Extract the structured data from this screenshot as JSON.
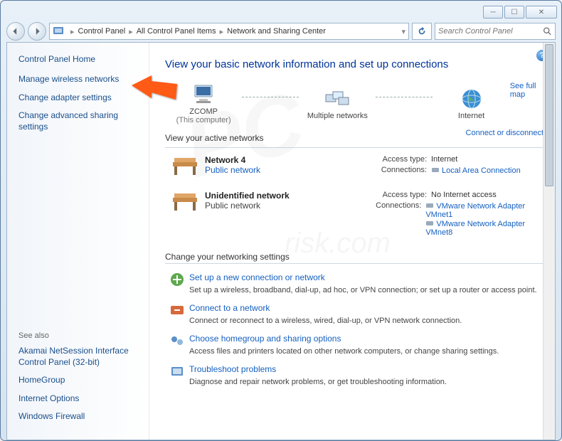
{
  "breadcrumbs": [
    "Control Panel",
    "All Control Panel Items",
    "Network and Sharing Center"
  ],
  "search": {
    "placeholder": "Search Control Panel"
  },
  "sidebar": {
    "home": "Control Panel Home",
    "links": [
      "Manage wireless networks",
      "Change adapter settings",
      "Change advanced sharing settings"
    ],
    "see_also_label": "See also",
    "see_also": [
      "Akamai NetSession Interface Control Panel (32-bit)",
      "HomeGroup",
      "Internet Options",
      "Windows Firewall"
    ]
  },
  "main": {
    "heading": "View your basic network information and set up connections",
    "see_full_map": "See full map",
    "nodes": {
      "computer": {
        "label": "ZCOMP",
        "sub": "(This computer)"
      },
      "middle": {
        "label": "Multiple networks"
      },
      "internet": {
        "label": "Internet"
      }
    },
    "active_label": "View your active networks",
    "cd_link": "Connect or disconnect",
    "networks": [
      {
        "name": "Network  4",
        "type": "Public network",
        "type_link": true,
        "access_lbl": "Access type:",
        "access_val": "Internet",
        "conn_lbl": "Connections:",
        "connections": [
          "Local Area Connection"
        ]
      },
      {
        "name": "Unidentified network",
        "type": "Public network",
        "type_link": false,
        "access_lbl": "Access type:",
        "access_val": "No Internet access",
        "conn_lbl": "Connections:",
        "connections": [
          "VMware Network Adapter VMnet1",
          "VMware Network Adapter VMnet8"
        ]
      }
    ],
    "change_settings_label": "Change your networking settings",
    "settings": [
      {
        "title": "Set up a new connection or network",
        "desc": "Set up a wireless, broadband, dial-up, ad hoc, or VPN connection; or set up a router or access point."
      },
      {
        "title": "Connect to a network",
        "desc": "Connect or reconnect to a wireless, wired, dial-up, or VPN network connection."
      },
      {
        "title": "Choose homegroup and sharing options",
        "desc": "Access files and printers located on other network computers, or change sharing settings."
      },
      {
        "title": "Troubleshoot problems",
        "desc": "Diagnose and repair network problems, or get troubleshooting information."
      }
    ]
  }
}
